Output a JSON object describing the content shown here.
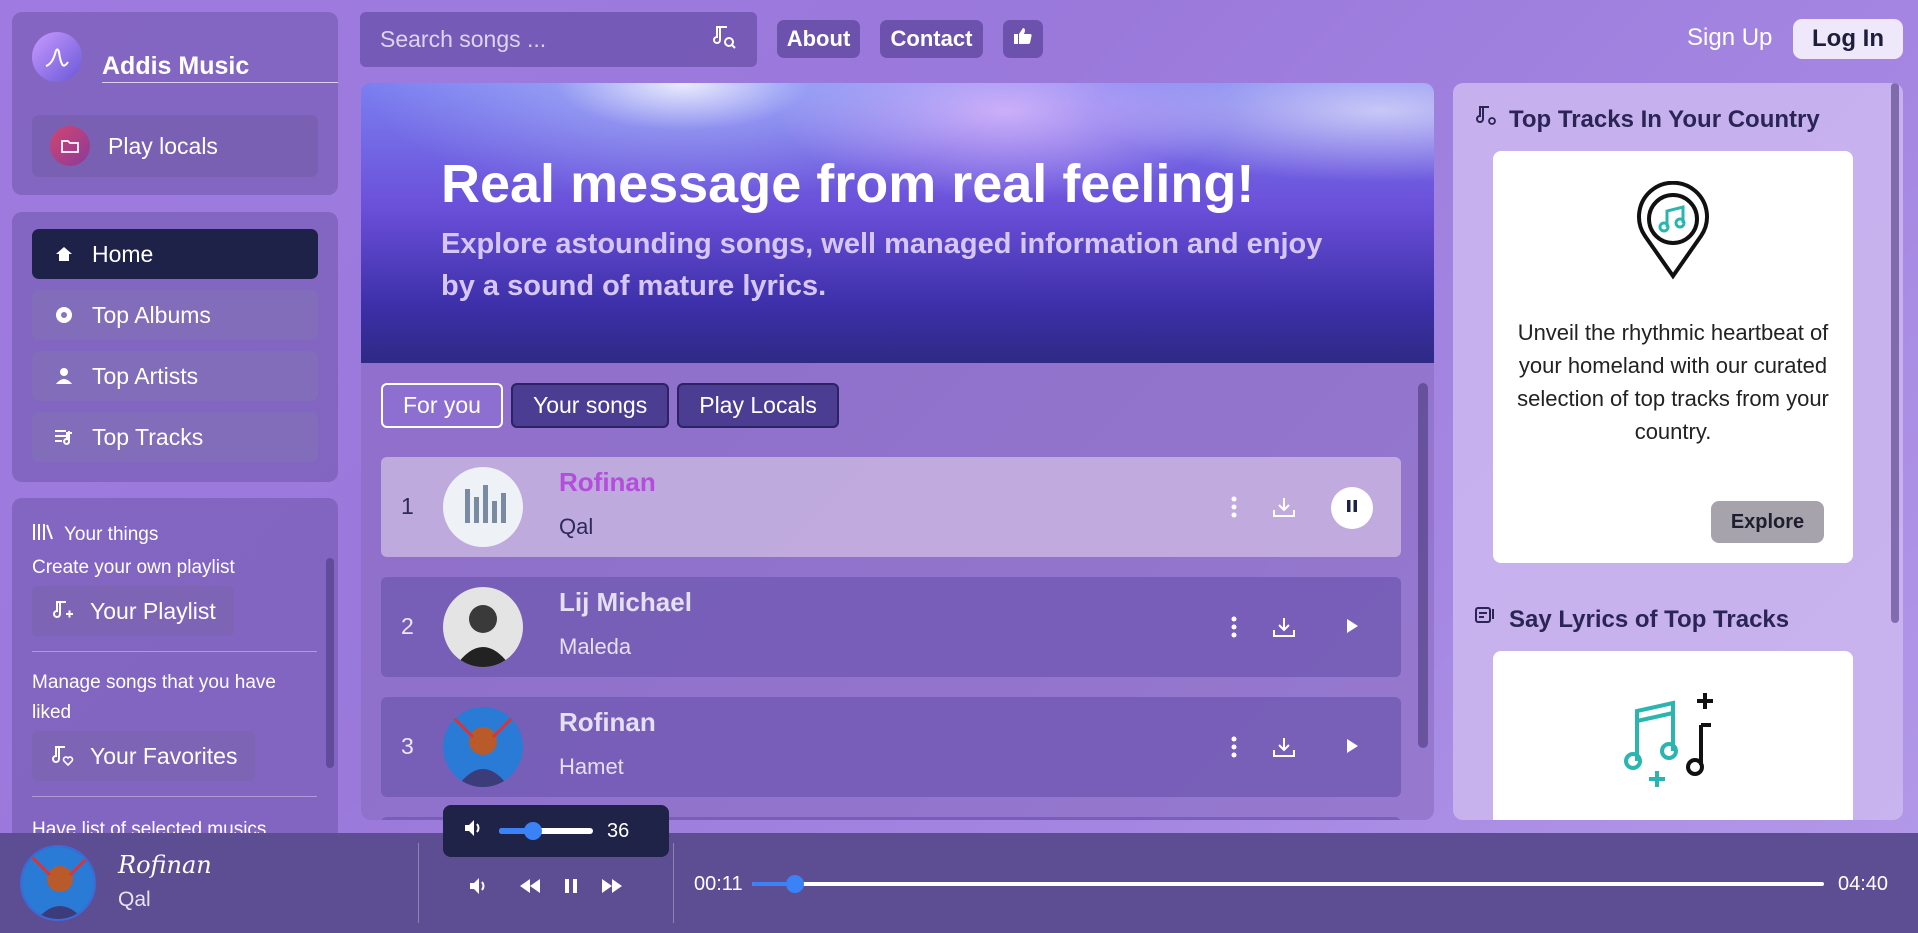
{
  "brand": {
    "title": "Addis Music",
    "play_locals": "Play locals"
  },
  "nav": {
    "items": [
      {
        "label": "Home",
        "icon": "home-icon",
        "active": true
      },
      {
        "label": "Top Albums",
        "icon": "disc-icon",
        "active": false
      },
      {
        "label": "Top Artists",
        "icon": "user-icon",
        "active": false
      },
      {
        "label": "Top Tracks",
        "icon": "playlist-icon",
        "active": false
      }
    ]
  },
  "things": {
    "header": "Your things",
    "playlist_desc": "Create your own playlist",
    "playlist_btn": "Your Playlist",
    "favorites_desc": "Manage songs that you have liked",
    "favorites_btn": "Your Favorites",
    "more_desc": "Have list of selected musics"
  },
  "header": {
    "search_placeholder": "Search songs ...",
    "about": "About",
    "contact": "Contact",
    "sign_up": "Sign Up",
    "log_in": "Log In"
  },
  "hero": {
    "title": "Real message from real feeling!",
    "subtitle": "Explore astounding songs, well managed information and enjoy by a sound of mature lyrics."
  },
  "tabs": [
    {
      "label": "For you",
      "active": true
    },
    {
      "label": "Your songs",
      "active": false
    },
    {
      "label": "Play Locals",
      "active": false
    }
  ],
  "tracks": [
    {
      "num": "1",
      "artist": "Rofinan",
      "song": "Qal",
      "playing": true
    },
    {
      "num": "2",
      "artist": "Lij Michael",
      "song": "Maleda",
      "playing": false
    },
    {
      "num": "3",
      "artist": "Rofinan",
      "song": "Hamet",
      "playing": false
    }
  ],
  "aside": {
    "top_tracks_title": "Top Tracks In Your Country",
    "top_tracks_desc": "Unveil the rhythmic heartbeat of your homeland with our curated selection of top tracks from your country.",
    "explore": "Explore",
    "lyrics_title": "Say Lyrics of Top Tracks"
  },
  "player": {
    "artist": "Rofinan",
    "song": "Qal",
    "volume": "36",
    "volume_fraction": 0.36,
    "elapsed": "00:11",
    "duration": "04:40",
    "progress_fraction": 0.04
  },
  "colors": {
    "accent": "#3b82f6",
    "active_nav": "#1e2148",
    "playing_artist": "#b44ddb"
  }
}
